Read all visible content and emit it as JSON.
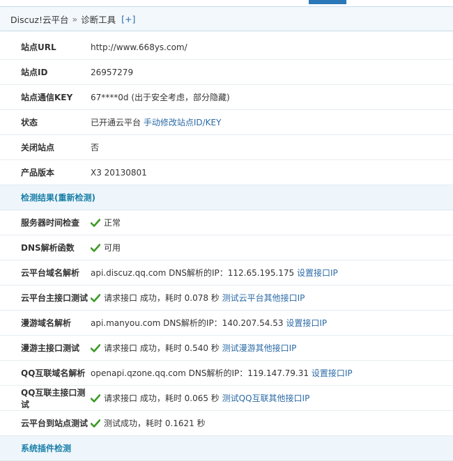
{
  "breadcrumb": {
    "root": "Discuz!云平台",
    "separator": "»",
    "current": "诊断工具",
    "add_label": "[+]"
  },
  "site_info": [
    {
      "label": "站点URL",
      "value": "http://www.668ys.com/"
    },
    {
      "label": "站点ID",
      "value": "26957279"
    },
    {
      "label": "站点通信KEY",
      "value": "67****0d (出于安全考虑，部分隐藏)"
    },
    {
      "label": "状态",
      "value": "已开通云平台",
      "link": "手动修改站点ID/KEY"
    },
    {
      "label": "关闭站点",
      "value": "否"
    },
    {
      "label": "产品版本",
      "value": "X3 20130801"
    }
  ],
  "detect_section": {
    "title": "检测结果(",
    "link": "重新检测",
    "title_end": ")"
  },
  "checks": {
    "server_time": {
      "label": "服务器时间检查",
      "value": "正常"
    },
    "dns_func": {
      "label": "DNS解析函数",
      "value": "可用"
    },
    "cloud_dns": {
      "label": "云平台域名解析",
      "value": "api.discuz.qq.com DNS解析的IP：112.65.195.175",
      "link": "设置接口IP"
    },
    "cloud_api": {
      "label": "云平台主接口测试",
      "value": "请求接口 成功，耗时 0.078 秒",
      "link": "测试云平台其他接口IP"
    },
    "manyou_dns": {
      "label": "漫游域名解析",
      "value": "api.manyou.com DNS解析的IP：140.207.54.53",
      "link": "设置接口IP"
    },
    "manyou_api": {
      "label": "漫游主接口测试",
      "value": "请求接口 成功，耗时 0.540 秒",
      "link": "测试漫游其他接口IP"
    },
    "qq_dns": {
      "label": "QQ互联域名解析",
      "value": "openapi.qzone.qq.com DNS解析的IP：119.147.79.31",
      "link": "设置接口IP"
    },
    "qq_api": {
      "label": "QQ互联主接口测试",
      "value": "请求接口 成功，耗时 0.065 秒",
      "link": "测试QQ互联其他接口IP"
    },
    "cloud_to_site": {
      "label": "云平台到站点测试",
      "value": "测试成功，耗时 0.1621 秒"
    }
  },
  "plugin_section": {
    "title": "系统插件检测"
  },
  "colors": {
    "accent": "#2b6aa6",
    "section_bg": "#eef6fb",
    "check": "#3a9a24"
  },
  "icons": {
    "ok": "check-icon"
  }
}
